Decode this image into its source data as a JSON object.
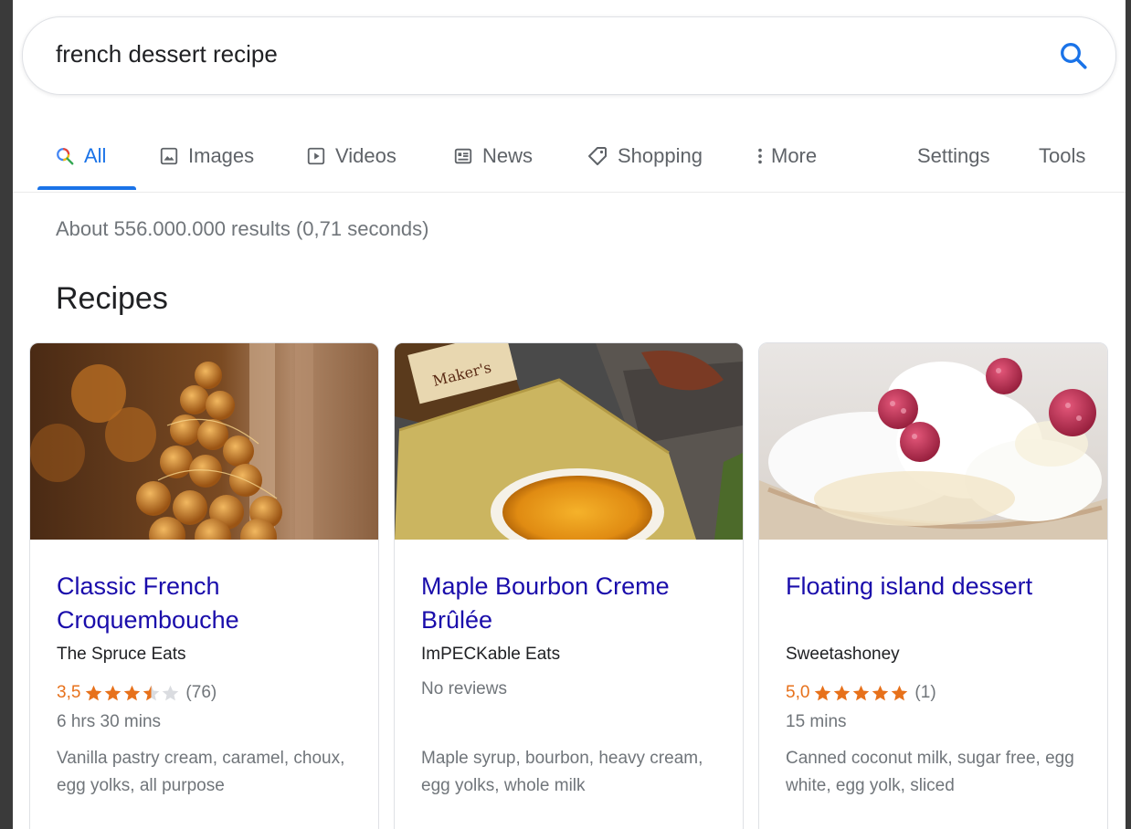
{
  "search": {
    "query": "french dessert recipe",
    "search_icon": "search-icon",
    "accent_color": "#1a73e8"
  },
  "tabs": [
    {
      "label": "All",
      "icon": "search-icon",
      "active": true
    },
    {
      "label": "Images",
      "icon": "image-icon"
    },
    {
      "label": "Videos",
      "icon": "play-icon"
    },
    {
      "label": "News",
      "icon": "news-icon"
    },
    {
      "label": "Shopping",
      "icon": "tag-icon"
    },
    {
      "label": "More",
      "icon": "more-vert-icon"
    },
    {
      "label": "Settings"
    },
    {
      "label": "Tools"
    }
  ],
  "results": {
    "stats": "About 556.000.000 results (0,71 seconds)"
  },
  "recipes": {
    "heading": "Recipes",
    "cards": [
      {
        "title": "Classic French Croquembouche",
        "source": "The Spruce Eats",
        "rating_text": "3,5",
        "rating": 3.5,
        "reviews": "(76)",
        "time": "6 hrs 30 mins",
        "ingredients": "Vanilla pastry cream, caramel, choux, egg yolks, all purpose"
      },
      {
        "title": "Maple Bourbon Creme Brûlée",
        "source": "ImPECKable Eats",
        "no_reviews": "No reviews",
        "ingredients": "Maple syrup, bourbon, heavy cream, egg yolks, whole milk"
      },
      {
        "title": "Floating island dessert",
        "source": "Sweetashoney",
        "rating_text": "5,0",
        "rating": 5.0,
        "reviews": "(1)",
        "time": "15 mins",
        "ingredients": "Canned coconut milk, sugar free, egg white, egg yolk, sliced"
      }
    ]
  },
  "colors": {
    "link": "#1a0dab",
    "star": "#e7711b",
    "muted": "#70757a"
  }
}
